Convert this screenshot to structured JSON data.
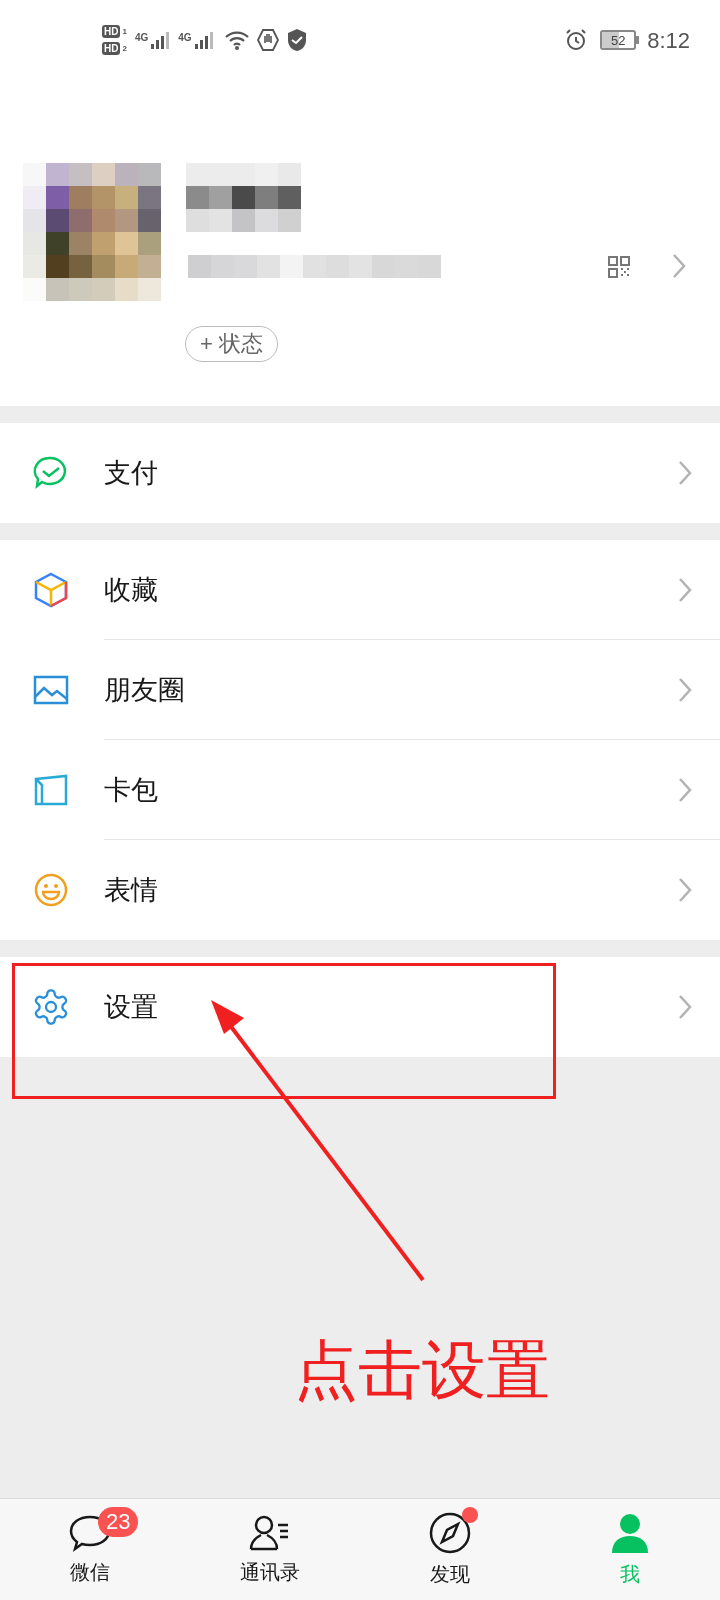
{
  "status_bar": {
    "sims": [
      {
        "label": "HD",
        "slot": "1"
      },
      {
        "label": "HD",
        "slot": "2"
      }
    ],
    "networks": [
      "4G",
      "4G"
    ],
    "battery": "52",
    "time": "8:12"
  },
  "profile": {
    "status_button": "+ 状态"
  },
  "menu_groups": [
    [
      {
        "label": "支付"
      }
    ],
    [
      {
        "label": "收藏"
      },
      {
        "label": "朋友圈"
      },
      {
        "label": "卡包"
      },
      {
        "label": "表情"
      }
    ],
    [
      {
        "label": "设置"
      }
    ]
  ],
  "annotation": {
    "text": "点击设置"
  },
  "tabs": [
    {
      "label": "微信",
      "selected": false,
      "badge": "23"
    },
    {
      "label": "通讯录",
      "selected": false
    },
    {
      "label": "发现",
      "selected": false,
      "dot": true
    },
    {
      "label": "我",
      "selected": true
    }
  ]
}
